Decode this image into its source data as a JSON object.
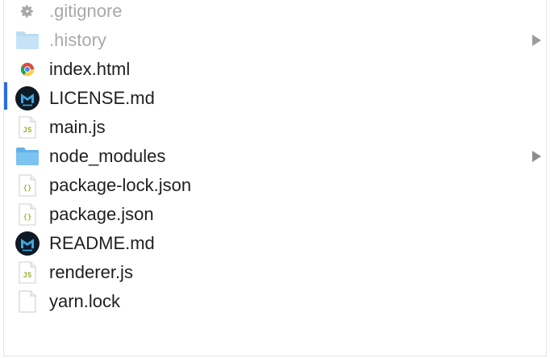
{
  "colors": {
    "folder": "#7cc3f1",
    "folder_dim": "#b9dcf3",
    "markdown_bg": "#0e1a24",
    "markdown_fg": "#3aa7e3",
    "js_tag": "#9aad2f",
    "json_tag": "#a8b83a",
    "selection": "#2b6de0",
    "chevron": "#8e8e8e"
  },
  "files": [
    {
      "name": ".gitignore",
      "icon": "gear-icon",
      "dim": true,
      "folder": false
    },
    {
      "name": ".history",
      "icon": "folder-icon",
      "dim": true,
      "folder": true
    },
    {
      "name": "index.html",
      "icon": "chrome-icon",
      "dim": false,
      "folder": false
    },
    {
      "name": "LICENSE.md",
      "icon": "markdown-icon",
      "dim": false,
      "folder": false
    },
    {
      "name": "main.js",
      "icon": "js-file-icon",
      "dim": false,
      "folder": false,
      "tag": "JS"
    },
    {
      "name": "node_modules",
      "icon": "folder-icon",
      "dim": false,
      "folder": true
    },
    {
      "name": "package-lock.json",
      "icon": "json-file-icon",
      "dim": false,
      "folder": false,
      "tag": "{}"
    },
    {
      "name": "package.json",
      "icon": "json-file-icon",
      "dim": false,
      "folder": false,
      "tag": "{}"
    },
    {
      "name": "README.md",
      "icon": "markdown-icon",
      "dim": false,
      "folder": false
    },
    {
      "name": "renderer.js",
      "icon": "js-file-icon",
      "dim": false,
      "folder": false,
      "tag": "JS"
    },
    {
      "name": "yarn.lock",
      "icon": "file-icon",
      "dim": false,
      "folder": false
    }
  ]
}
